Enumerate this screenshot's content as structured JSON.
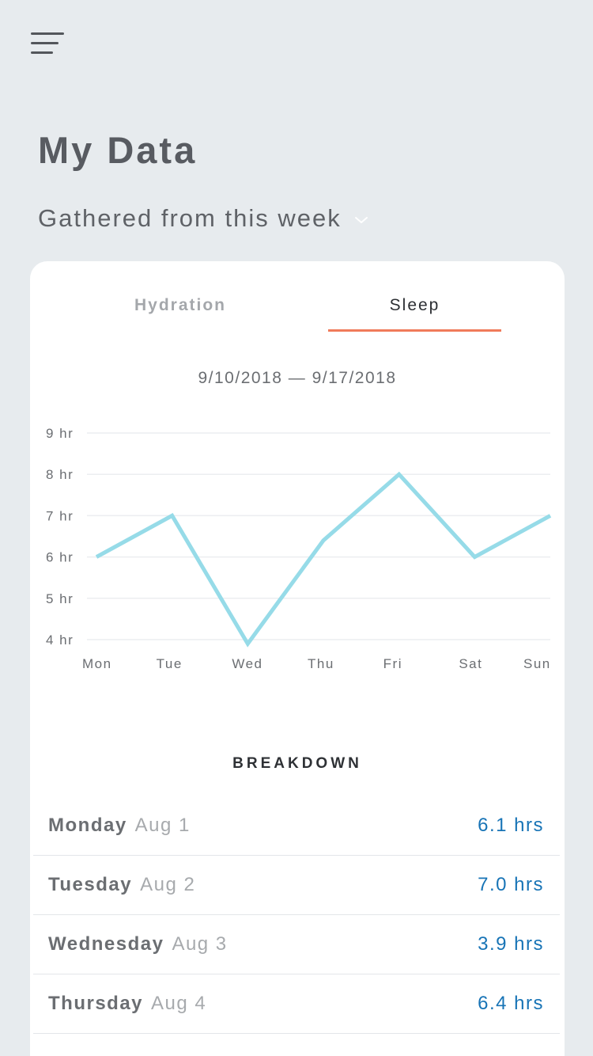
{
  "header": {
    "title": "My Data",
    "range_label": "Gathered from this week"
  },
  "tabs": [
    {
      "label": "Hydration",
      "active": false
    },
    {
      "label": "Sleep",
      "active": true
    }
  ],
  "date_range": "9/10/2018 — 9/17/2018",
  "chart_data": {
    "type": "line",
    "x": [
      "Mon",
      "Tue",
      "Wed",
      "Thu",
      "Fri",
      "Sat",
      "Sun"
    ],
    "y_ticks": [
      "9 hr",
      "8 hr",
      "7 hr",
      "6 hr",
      "5 hr",
      "4 hr"
    ],
    "ylim": [
      4,
      9
    ],
    "series": [
      {
        "values": [
          6.0,
          7.0,
          3.9,
          6.4,
          8.0,
          6.0,
          7.0
        ],
        "color": "#96dbe8"
      }
    ],
    "grid": true
  },
  "breakdown": {
    "title": "BREAKDOWN",
    "rows": [
      {
        "day": "Monday",
        "date": "Aug 1",
        "value": "6.1 hrs"
      },
      {
        "day": "Tuesday",
        "date": "Aug 2",
        "value": "7.0 hrs"
      },
      {
        "day": "Wednesday",
        "date": "Aug 3",
        "value": "3.9 hrs"
      },
      {
        "day": "Thursday",
        "date": "Aug 4",
        "value": "6.4 hrs"
      }
    ]
  },
  "colors": {
    "background": "#e7ebee",
    "accent_underline": "#f07b5a",
    "line": "#96dbe8",
    "value_text": "#1874b6"
  },
  "icons": [
    "menu-icon",
    "chevron-down-icon"
  ]
}
